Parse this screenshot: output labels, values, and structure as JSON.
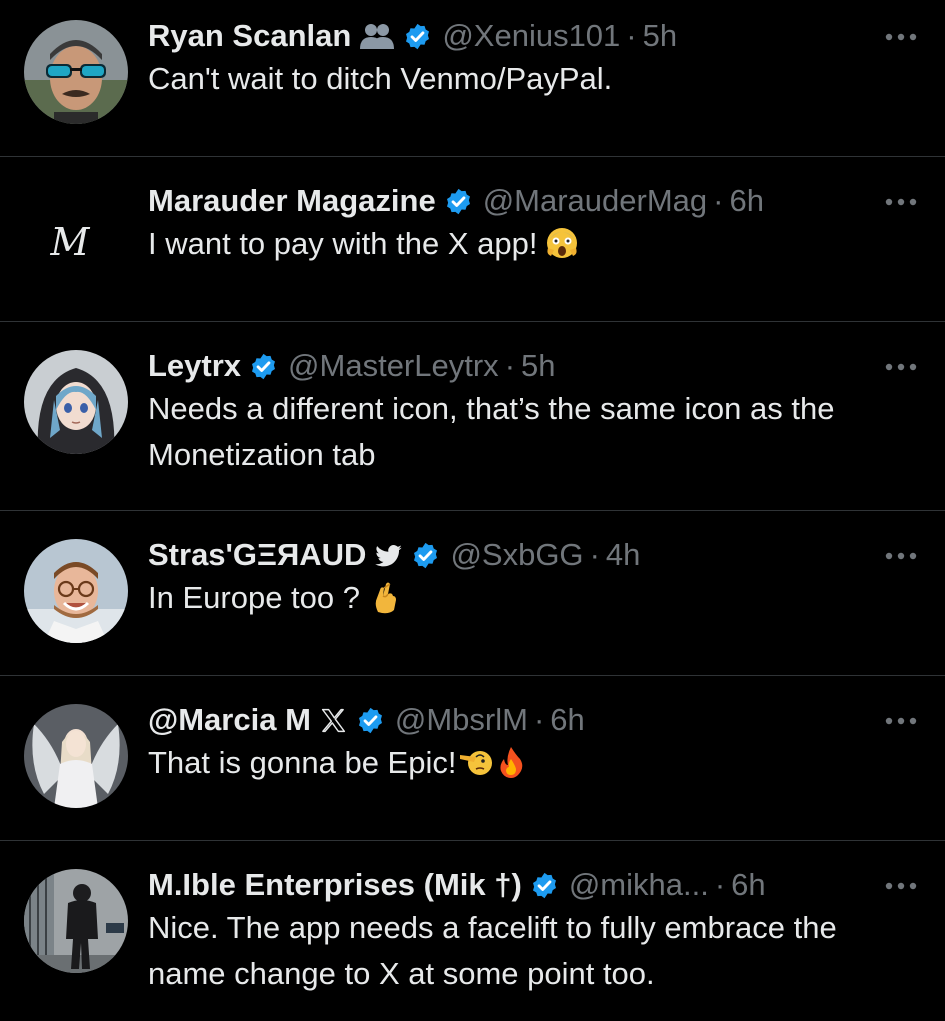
{
  "tweets": [
    {
      "name": "Ryan Scanlan",
      "handle": "@Xenius101",
      "separator": "·",
      "time": "5h",
      "text": "Can't wait to ditch Venmo/PayPal."
    },
    {
      "name": "Marauder Magazine",
      "handle": "@MarauderMag",
      "separator": "·",
      "time": "6h",
      "text": "I want to pay with the X app!",
      "avatar_letter": "M"
    },
    {
      "name": "Leytrx",
      "handle": "@MasterLeytrx",
      "separator": "·",
      "time": "5h",
      "text": "Needs a different icon, that’s the same icon as the Monetization tab"
    },
    {
      "name": "Stras'GΞЯAUD",
      "handle": "@SxbGG",
      "separator": "·",
      "time": "4h",
      "text": "In Europe too ?"
    },
    {
      "name": "@Marcia M",
      "handle": "@MbsrlM",
      "separator": "·",
      "time": "6h",
      "text": "That is gonna be Epic!"
    },
    {
      "name": "M.Ible Enterprises (Mik †)",
      "handle": "@mikha...",
      "separator": "·",
      "time": "6h",
      "text": "Nice. The app needs a facelift to fully embrace the name change to X at some point too."
    }
  ],
  "colors": {
    "background": "#000000",
    "text_primary": "#e7e9ea",
    "text_secondary": "#71767b",
    "verified_blue": "#1d9bf0",
    "divider": "#2f3336"
  },
  "icons": {
    "verified": "verified-badge-icon",
    "more": "more-options-icon",
    "affiliation_group": "group-affiliation-icon",
    "twitter_bird": "twitter-bird-icon",
    "x_logo": "x-logo-icon"
  }
}
